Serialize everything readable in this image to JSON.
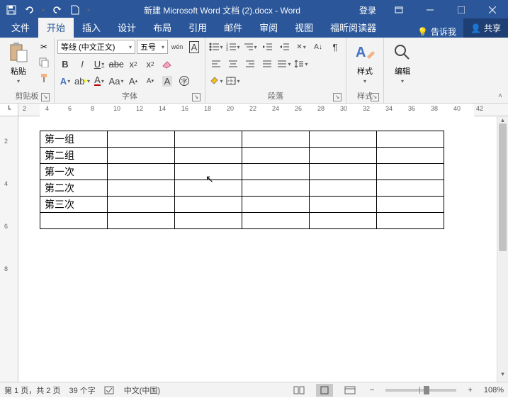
{
  "titlebar": {
    "doc_title": "新建 Microsoft Word 文档 (2).docx  -  Word",
    "login": "登录"
  },
  "tabs": {
    "file": "文件",
    "home": "开始",
    "insert": "插入",
    "design": "设计",
    "layout": "布局",
    "references": "引用",
    "mailings": "邮件",
    "review": "审阅",
    "view": "视图",
    "foxit": "福昕阅读器",
    "tell_me": "告诉我",
    "share": "共享"
  },
  "ribbon": {
    "clipboard": {
      "paste": "粘贴",
      "label": "剪贴板"
    },
    "font": {
      "name": "等线 (中文正文)",
      "size": "五号",
      "ruby": "wén",
      "label": "字体"
    },
    "paragraph": {
      "label": "段落"
    },
    "styles": {
      "styles": "样式",
      "label": "样式"
    },
    "editing": {
      "edit": "编辑"
    }
  },
  "table": {
    "rows": [
      [
        "第一组",
        "",
        "",
        "",
        "",
        ""
      ],
      [
        "第二组",
        "",
        "",
        "",
        "",
        ""
      ],
      [
        "第一次",
        "",
        "",
        "",
        "",
        ""
      ],
      [
        "第二次",
        "",
        "",
        "",
        "",
        ""
      ],
      [
        "第三次",
        "",
        "",
        "",
        "",
        ""
      ],
      [
        "",
        "",
        "",
        "",
        "",
        ""
      ]
    ]
  },
  "ruler_h": [
    2,
    4,
    6,
    8,
    10,
    12,
    14,
    16,
    18,
    20,
    22,
    24,
    26,
    28,
    30,
    32,
    34,
    36,
    38,
    40,
    42
  ],
  "ruler_v": [
    2,
    4,
    6,
    8
  ],
  "status": {
    "page": "第 1 页，共 2 页",
    "words": "39 个字",
    "lang": "中文(中国)",
    "zoom": "108%"
  }
}
